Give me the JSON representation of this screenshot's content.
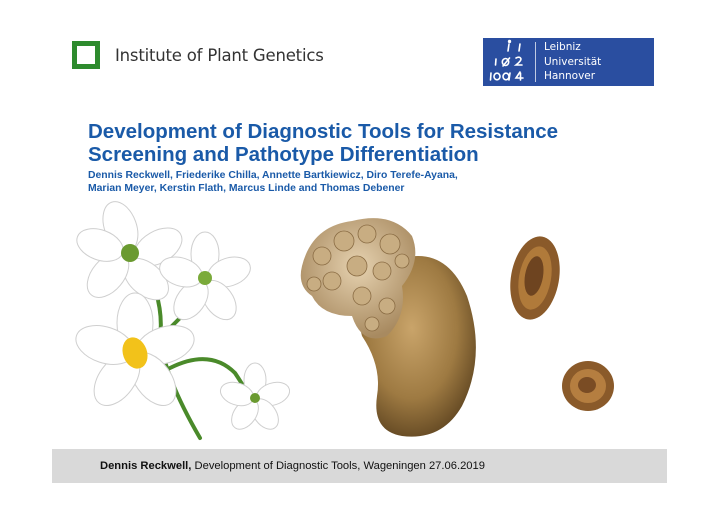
{
  "header": {
    "institute_name": "Institute of Plant Genetics",
    "university_logo": {
      "lines": [
        "Leibniz",
        "Universität",
        "Hannover"
      ],
      "glyph_text": "i i io 2 io a 4"
    }
  },
  "slide": {
    "title_line1": "Development of Diagnostic Tools for Resistance",
    "title_line2": "Screening and Pathotype Differentiation",
    "authors_line1": "Dennis Reckwell, Friederike Chilla, Annette Bartkiewicz, Diro Terefe-Ayana,",
    "authors_line2": "Marian Meyer, Kerstin Flath, Marcus Linde and Thomas Debener"
  },
  "images": {
    "flowers": "potato-flower-image",
    "tuber": "wart-infected-potato-tuber-image",
    "spore1": "resting-spore-image",
    "spore2": "resting-spore-image"
  },
  "footer": {
    "presenter": "Dennis Reckwell,",
    "details": " Development of Diagnostic Tools, Wageningen 27.06.2019"
  },
  "colors": {
    "title_blue": "#1a5aa8",
    "logo_green": "#2e8b2e",
    "luh_blue": "#2a4ea0",
    "footer_gray": "#d9d9d9"
  }
}
